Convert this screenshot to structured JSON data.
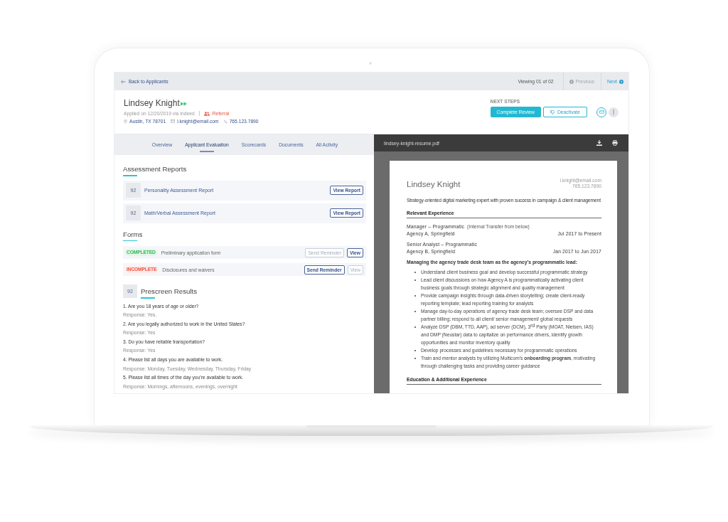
{
  "top_bar": {
    "back_link": "Back to Applicants",
    "viewing": "Viewing 01 of 02",
    "previous": {
      "label": "Previous",
      "disabled": true
    },
    "next": {
      "label": "Next",
      "disabled": false
    }
  },
  "applicant": {
    "name": "Lindsey Knight",
    "applied": "Applied on 12/20/2019 via Indeed",
    "source": "Referral",
    "location": "Austin, TX 78701",
    "email": "l.knight@email.com",
    "phone": "765.123.7890"
  },
  "next_steps": {
    "label": "NEXT STEPS",
    "buttons": [
      {
        "label": "Complete Review",
        "kind": "primary"
      },
      {
        "label": "Deactivate",
        "kind": "secondary"
      }
    ]
  },
  "tabs": [
    {
      "label": "Overview",
      "selected": false
    },
    {
      "label": "Applicant Evaluation",
      "selected": true
    },
    {
      "label": "Scorecards",
      "selected": false
    },
    {
      "label": "Documents",
      "selected": false
    },
    {
      "label": "All Activity",
      "selected": false
    }
  ],
  "assessment_reports": {
    "title": "Assessment Reports",
    "items": [
      {
        "score": "92",
        "name": "Personality Assessment Report",
        "action": "View Report"
      },
      {
        "score": "92",
        "name": "Math/Verbal Assessment Report",
        "action": "View Report"
      }
    ]
  },
  "forms": {
    "title": "Forms",
    "items": [
      {
        "status": "COMPLETED",
        "kind": "completed",
        "name": "Preliminary application form",
        "actions": [
          {
            "label": "Send Reminder",
            "disabled": true
          },
          {
            "label": "View",
            "disabled": false
          }
        ]
      },
      {
        "status": "INCOMPLETE",
        "kind": "incomplete",
        "name": "Disclosures and waivers",
        "actions": [
          {
            "label": "Send Reminder",
            "disabled": false
          },
          {
            "label": "View",
            "disabled": true
          }
        ]
      }
    ]
  },
  "prescreen": {
    "score": "92",
    "title": "Prescreen Results",
    "questions": [
      {
        "question": "1. Are you 18 years of age or older?",
        "response": "Response: Yes."
      },
      {
        "question": "2. Are you legally authorized to work in the United States?",
        "response": "Response: Yes"
      },
      {
        "question": "3. Do you have reliable transportation?",
        "response": "Response: Yes"
      },
      {
        "question": "4. Please list all days you are available to work.",
        "response": "Response: Monday, Tuesday, Wednesday, Thursday, Friday"
      },
      {
        "question": "5. Please list all times of the day you’re available to work.",
        "response": "Response: Mornings, afternoons, evenings, overnight"
      }
    ]
  },
  "document": {
    "filename": "lindsey-knight-resume.pdf",
    "resume": {
      "name": "Lindsey Knight",
      "email": "l.knight@email.com",
      "phone": "765.123.7890",
      "summary": "Strategy-oriented digital marketing expert with proven success in campaign & client management",
      "sections": [
        {
          "title": "Relevant Experience",
          "jobs": [
            {
              "title": "Manager – Programmatic",
              "note": "(Internal Transfer from below)",
              "company": "Agency A, Springfield",
              "dates": "Jul 2017 to Present"
            },
            {
              "title": "Senior Analyst – Programmatic",
              "company": "Agency B, Springfield",
              "dates": "Jan 2017 to Jun 2017"
            }
          ],
          "subheading": "Managing the agency trade desk team as the agency’s programmatic lead:",
          "bullets": [
            "Understand client business goal and develop successful programmatic strategy",
            "Lead client discussions on how Agency A is programmatically activating client business goals through strategic alignment and quality management",
            "Provide campaign insights through data-driven storytelling; create client-ready reporting template; lead reporting training for analysts",
            "Manage day-to-day operations of agency trade desk team; oversee DSP and data partner billing; respond to all client/ senior management/ global requests",
            "Analyze DSP (DBM, TTD, AAP), ad server (DCM), 3$^{rd}$ Party (MOAT, Nielsen, IAS) and DMP (Neustar) data to capitalize on performance drivers, identify growth opportunities and monitor inventory quality",
            "Develop processes and guidelines necessary for programmatic operations",
            "Train and mentor analysts by utilizing Multicom’s **onboarding program**, motivating through challenging tasks and providing career guidance"
          ]
        },
        {
          "title": "Education & Additional Experience"
        }
      ]
    }
  }
}
